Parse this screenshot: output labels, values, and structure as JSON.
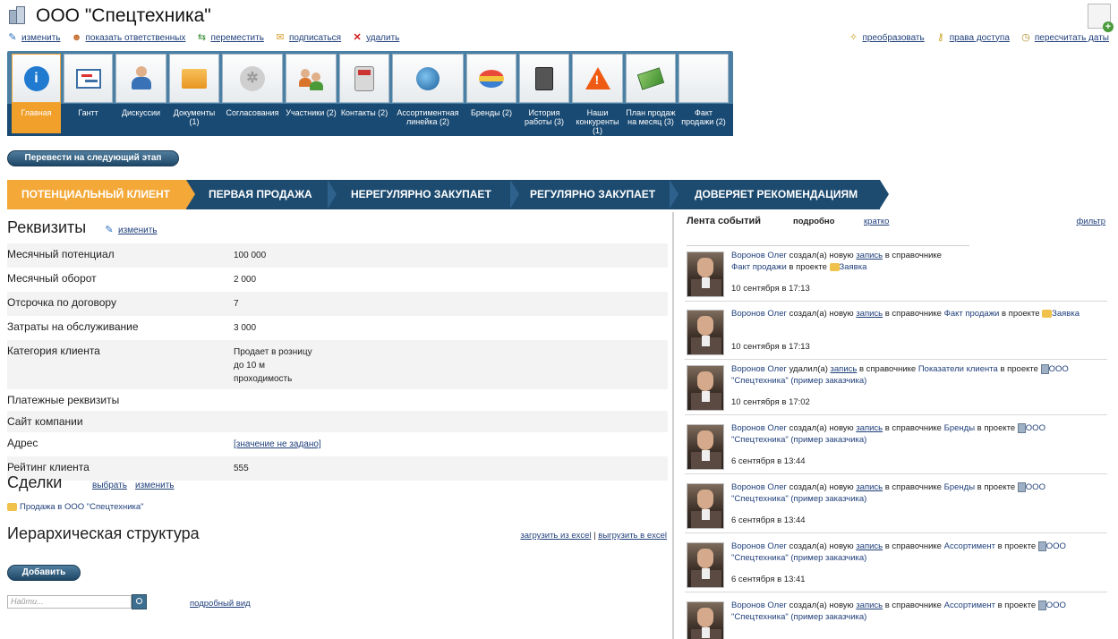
{
  "page_title": "ООО \"Спецтехника\"",
  "actions_left": [
    {
      "label": "изменить",
      "icon": "pencil-icon"
    },
    {
      "label": "показать ответственных",
      "icon": "person-icon"
    },
    {
      "label": "переместить",
      "icon": "move-icon"
    },
    {
      "label": "подписаться",
      "icon": "envelope-icon"
    },
    {
      "label": "удалить",
      "icon": "delete-icon"
    }
  ],
  "actions_right": [
    {
      "label": "преобразовать",
      "icon": "wand-icon"
    },
    {
      "label": "права доступа",
      "icon": "key-icon"
    },
    {
      "label": "пересчитать даты",
      "icon": "stopwatch-icon"
    }
  ],
  "toolbar": [
    {
      "label": "Главная",
      "icon": "info-icon"
    },
    {
      "label": "Гантт",
      "icon": "gantt-icon"
    },
    {
      "label": "Дискуссии",
      "icon": "user-icon"
    },
    {
      "label": "Документы (1)",
      "icon": "folder-icon"
    },
    {
      "label": "Согласования",
      "icon": "gear-icon"
    },
    {
      "label": "Участники (2)",
      "icon": "group-icon"
    },
    {
      "label": "Контакты (2)",
      "icon": "phone-icon"
    },
    {
      "label": "Ассортиментная линейка (2)",
      "icon": "globe-icon"
    },
    {
      "label": "Бренды (2)",
      "icon": "stack-icon"
    },
    {
      "label": "История работы (3)",
      "icon": "calculator-icon"
    },
    {
      "label": "Наши конкуренты (1)",
      "icon": "warning-icon"
    },
    {
      "label": "План продаж на месяц (3)",
      "icon": "money-icon"
    },
    {
      "label": "Факт продажи (2)",
      "icon": "blank-icon"
    }
  ],
  "next_stage_button": "Перевести на следующий этап",
  "stages": [
    "ПОТЕНЦИАЛЬНЫЙ КЛИЕНТ",
    "ПЕРВАЯ ПРОДАЖА",
    "НЕРЕГУЛЯРНО ЗАКУПАЕТ",
    "РЕГУЛЯРНО ЗАКУПАЕТ",
    "ДОВЕРЯЕТ РЕКОМЕНДАЦИЯМ"
  ],
  "requisites": {
    "title": "Реквизиты",
    "edit": "изменить",
    "rows": [
      {
        "key": "Месячный потенциал",
        "value": "100 000"
      },
      {
        "key": "Месячный оборот",
        "value": "2 000"
      },
      {
        "key": "Отсрочка по договору",
        "value": "7"
      },
      {
        "key": "Затраты на обслуживание",
        "value": "3 000"
      },
      {
        "key": "Категория клиента",
        "value": "Продает в розницу\nдо 10 м\nпроходимость"
      },
      {
        "key": "Платежные реквизиты",
        "value": ""
      },
      {
        "key": "Сайт компании",
        "value": ""
      },
      {
        "key": "Адрес",
        "value": "[значение не задано]"
      },
      {
        "key": "Рейтинг клиента",
        "value": "555"
      }
    ]
  },
  "deals": {
    "title": "Сделки",
    "select": "выбрать",
    "edit": "изменить",
    "item": "Продажа в ООО \"Спецтехника\""
  },
  "hierarchy": {
    "title": "Иерархическая структура",
    "load": "загрузить из excel",
    "sep": "|",
    "export": "выгрузить в excel",
    "add": "Добавить",
    "search_placeholder": "Найти...",
    "detailed": "подробный вид"
  },
  "feed": {
    "title": "Лента событий",
    "detailed": "подробно",
    "brief": "кратко",
    "filter": "фильтр",
    "entries": [
      {
        "user": "Воронов Олег",
        "action": "создал(а) новую",
        "rec": "запись",
        "mid": "в справочнике",
        "ref": "Факт продажи",
        "in": "в проекте",
        "proj": "Заявка",
        "proj2": "",
        "date": "10 сентября в 17:13"
      },
      {
        "user": "Воронов Олег",
        "action": "создал(а) новую",
        "rec": "запись",
        "mid": "в справочнике",
        "ref": "Факт продажи",
        "in": "в проекте",
        "proj": "Заявка",
        "proj2": "",
        "date": "10 сентября в 17:13"
      },
      {
        "user": "Воронов Олег",
        "action": "удалил(а)",
        "rec": "запись",
        "mid": "в справочнике",
        "ref": "Показатели клиента",
        "in": "в проекте",
        "proj": "ООО",
        "proj2": "\"Спецтехника\" (пример заказчика)",
        "date": "10 сентября в 17:02"
      },
      {
        "user": "Воронов Олег",
        "action": "создал(а) новую",
        "rec": "запись",
        "mid": "в справочнике",
        "ref": "Бренды",
        "in": "в проекте",
        "proj": "ООО",
        "proj2": "\"Спецтехника\" (пример заказчика)",
        "date": "6 сентября в 13:44"
      },
      {
        "user": "Воронов Олег",
        "action": "создал(а) новую",
        "rec": "запись",
        "mid": "в справочнике",
        "ref": "Бренды",
        "in": "в проекте",
        "proj": "ООО",
        "proj2": "\"Спецтехника\" (пример заказчика)",
        "date": "6 сентября в 13:44"
      },
      {
        "user": "Воронов Олег",
        "action": "создал(а) новую",
        "rec": "запись",
        "mid": "в справочнике",
        "ref": "Ассортимент",
        "in": "в проекте",
        "proj": "ООО",
        "proj2": "\"Спецтехника\" (пример заказчика)",
        "date": "6 сентября в 13:41"
      },
      {
        "user": "Воронов Олег",
        "action": "создал(а) новую",
        "rec": "запись",
        "mid": "в справочнике",
        "ref": "Ассортимент",
        "in": "в проекте",
        "proj": "ООО",
        "proj2": "\"Спецтехника\" (пример заказчика)",
        "date": ""
      }
    ]
  }
}
